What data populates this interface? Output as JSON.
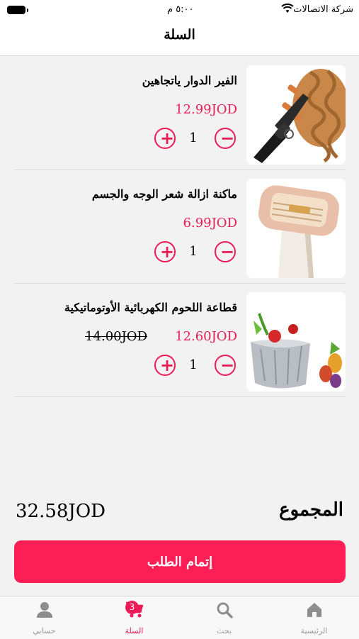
{
  "status_bar": {
    "carrier": "شركة الاتصالات",
    "time": "٥:٠٠ م"
  },
  "header": {
    "title": "السلة"
  },
  "cart": {
    "items": [
      {
        "name": "الفير الدوار ياتجاهين",
        "price": "12.99JOD",
        "old_price": "",
        "quantity": "1",
        "image": "hair-curler-image"
      },
      {
        "name": "ماكنة ازالة شعر الوجه والجسم",
        "price": "6.99JOD",
        "old_price": "",
        "quantity": "1",
        "image": "hair-remover-image"
      },
      {
        "name": "قطاعة اللحوم الكهربائية الأوتوماتيكية",
        "price": "12.60JOD",
        "old_price": "14.00JOD",
        "quantity": "1",
        "image": "meat-slicer-image"
      }
    ]
  },
  "summary": {
    "total_label": "المجموع",
    "total_value": "32.58JOD"
  },
  "checkout_label": "إتمام الطلب",
  "tabbar": {
    "tabs": [
      {
        "label": "الرئيسية",
        "icon": "home-icon"
      },
      {
        "label": "بحث",
        "icon": "search-icon"
      },
      {
        "label": "السلة",
        "icon": "cart-icon",
        "badge": "3"
      },
      {
        "label": "حسابي",
        "icon": "person-icon"
      }
    ]
  },
  "colors": {
    "accent": "#ea1b55",
    "checkout_bg": "#fb1f56",
    "background": "#f2f2f2"
  }
}
